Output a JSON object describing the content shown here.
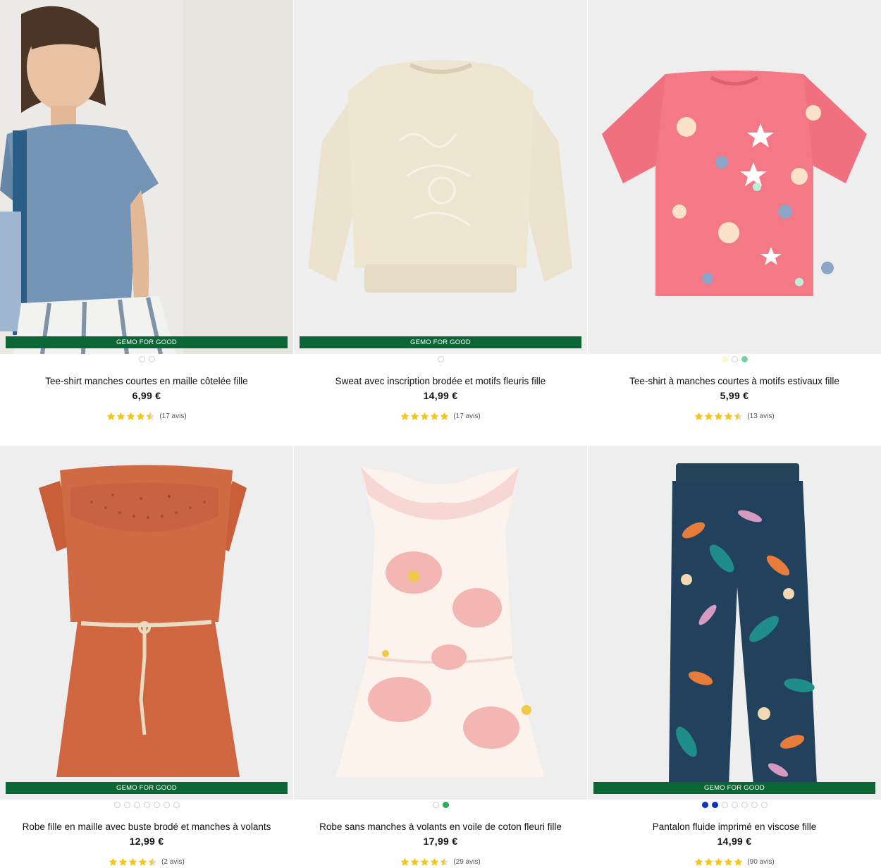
{
  "badge_label": "GEMO FOR GOOD",
  "colors": {
    "badge_bg": "#0b6636",
    "star": "#f5c518",
    "star_empty": "#dddddd"
  },
  "products": [
    {
      "title": "Tee-shirt manches courtes en maille côtelée fille",
      "price": "6,99 €",
      "rating": 4.5,
      "reviews": "(17 avis)",
      "has_badge": true,
      "swatches": [
        "#ffffff",
        "#ffffff"
      ],
      "image": "girl-in-blue-ribbed-tee"
    },
    {
      "title": "Sweat avec inscription brodée et motifs fleuris fille",
      "price": "14,99 €",
      "rating": 5,
      "reviews": "(17 avis)",
      "has_badge": true,
      "swatches": [
        "#ffffff"
      ],
      "image": "cream-sweatshirt"
    },
    {
      "title": "Tee-shirt à manches courtes à motifs estivaux fille",
      "price": "5,99 €",
      "rating": 4.5,
      "reviews": "(13 avis)",
      "has_badge": false,
      "swatches": [
        "#fff6cc",
        "#ffffff",
        "#6fd49a"
      ],
      "image": "pink-sea-print-tee"
    },
    {
      "title": "Robe fille en maille avec buste brodé et manches à volants",
      "price": "12,99 €",
      "rating": 4.5,
      "reviews": "(2 avis)",
      "has_badge": true,
      "swatches": [
        "#ffffff",
        "#ffffff",
        "#ffffff",
        "#ffffff",
        "#ffffff",
        "#ffffff",
        "#ffffff"
      ],
      "image": "terracotta-dress"
    },
    {
      "title": "Robe sans manches à volants en voile de coton fleuri fille",
      "price": "17,99 €",
      "rating": 4.5,
      "reviews": "(29 avis)",
      "has_badge": false,
      "swatches": [
        "#ffffff",
        "#2faa5a"
      ],
      "image": "pink-floral-dress"
    },
    {
      "title": "Pantalon fluide imprimé en viscose fille",
      "price": "14,99 €",
      "rating": 5,
      "reviews": "(90 avis)",
      "has_badge": true,
      "swatches": [
        "#1533b8",
        "#1533b8",
        "#ffffff",
        "#ffffff",
        "#ffffff",
        "#ffffff",
        "#ffffff"
      ],
      "image": "tropical-print-pants"
    }
  ]
}
